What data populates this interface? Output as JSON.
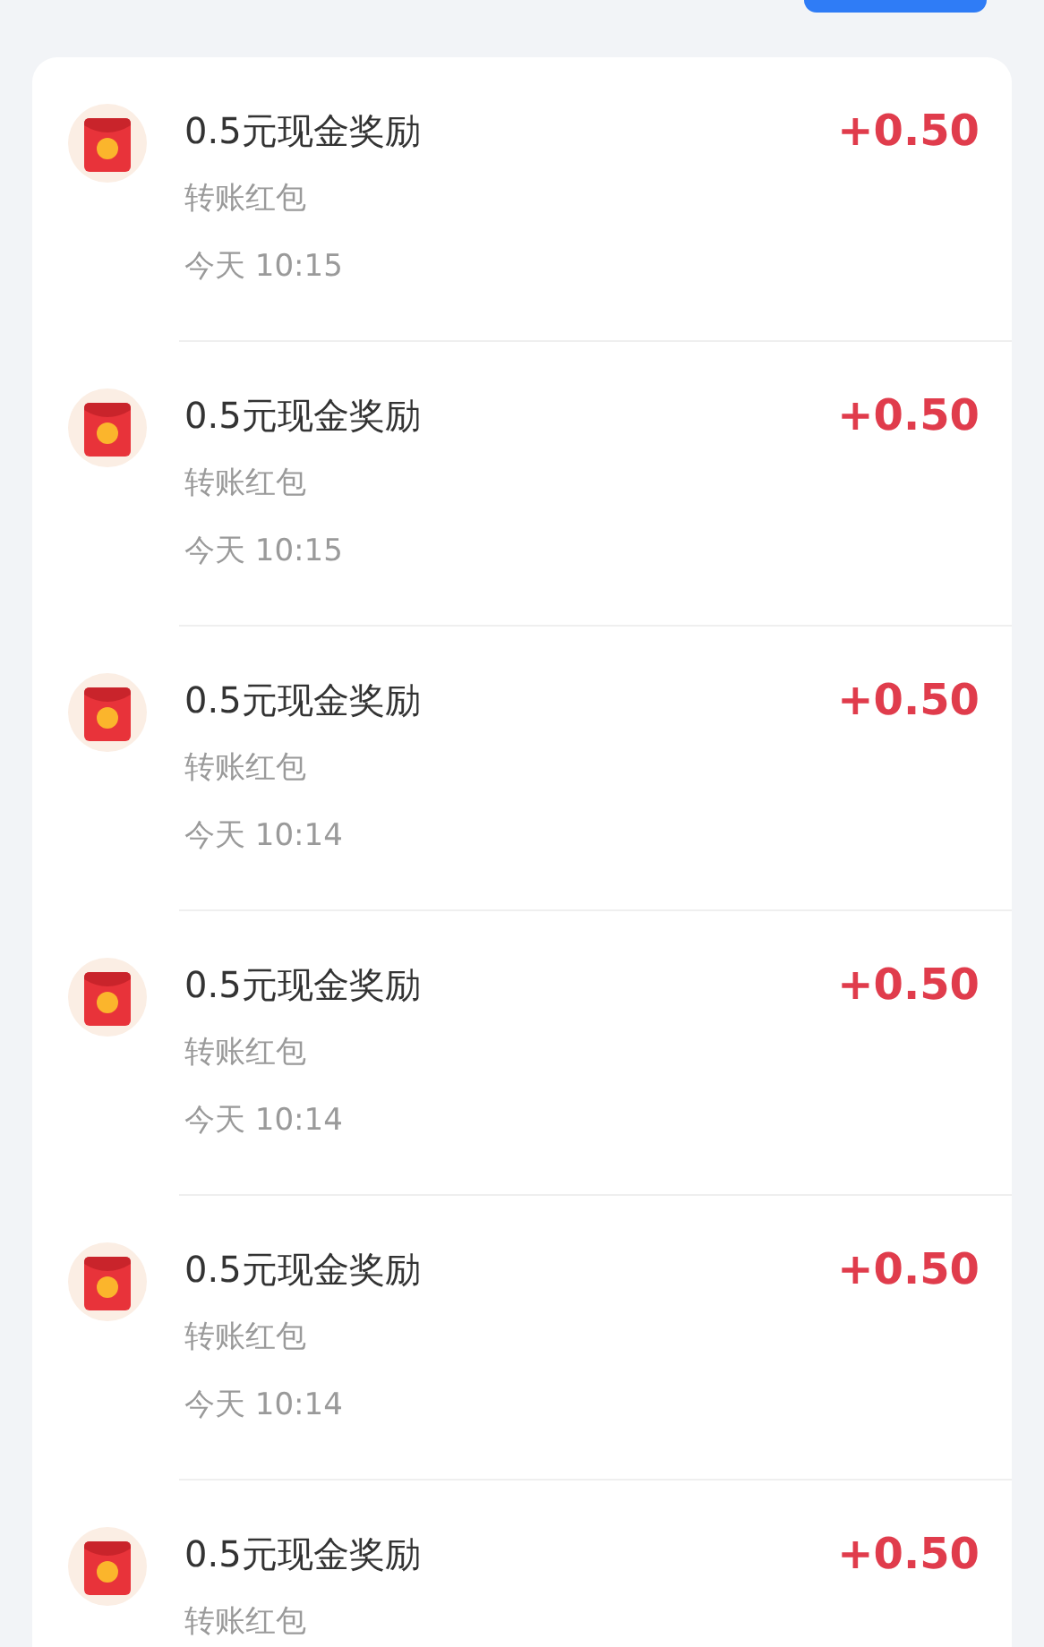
{
  "records": [
    {
      "title": "0.5元现金奖励",
      "type": "转账红包",
      "time": "今天 10:15",
      "amount": "+0.50"
    },
    {
      "title": "0.5元现金奖励",
      "type": "转账红包",
      "time": "今天 10:15",
      "amount": "+0.50"
    },
    {
      "title": "0.5元现金奖励",
      "type": "转账红包",
      "time": "今天 10:14",
      "amount": "+0.50"
    },
    {
      "title": "0.5元现金奖励",
      "type": "转账红包",
      "time": "今天 10:14",
      "amount": "+0.50"
    },
    {
      "title": "0.5元现金奖励",
      "type": "转账红包",
      "time": "今天 10:14",
      "amount": "+0.50"
    },
    {
      "title": "0.5元现金奖励",
      "type": "转账红包",
      "amount": "+0.50"
    }
  ]
}
